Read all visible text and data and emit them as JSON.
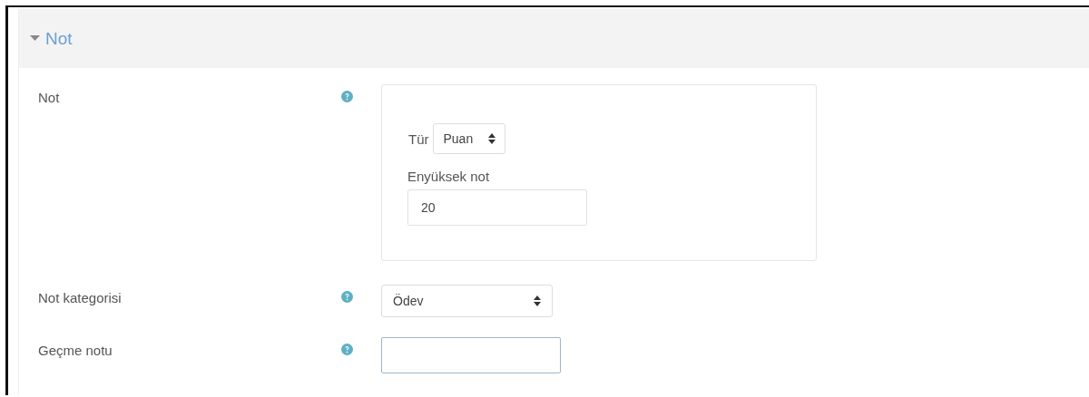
{
  "section": {
    "title": "Not",
    "expanded": true
  },
  "rows": [
    {
      "label": "Not",
      "kind": "group",
      "type_label": "Tür",
      "type_value": "Puan",
      "max_label": "Enyüksek not",
      "max_value": "20",
      "max_focused": false
    },
    {
      "label": "Not kategorisi",
      "kind": "select",
      "value": "Ödev"
    },
    {
      "label": "Geçme notu",
      "kind": "input",
      "value": "",
      "focused": true
    }
  ]
}
